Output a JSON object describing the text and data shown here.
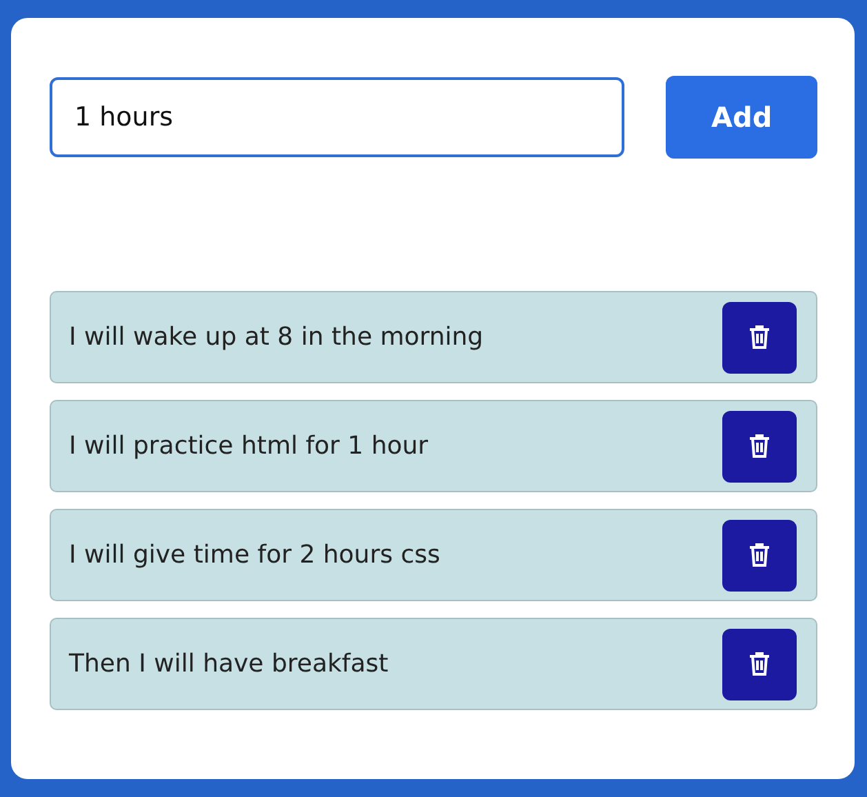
{
  "input": {
    "value": "1 hours"
  },
  "add_button": "Add",
  "tasks": [
    {
      "text": "I will wake up at 8 in the morning"
    },
    {
      "text": "I will practice html for 1 hour"
    },
    {
      "text": "I will give time for 2 hours css"
    },
    {
      "text": "Then I will have breakfast"
    }
  ]
}
